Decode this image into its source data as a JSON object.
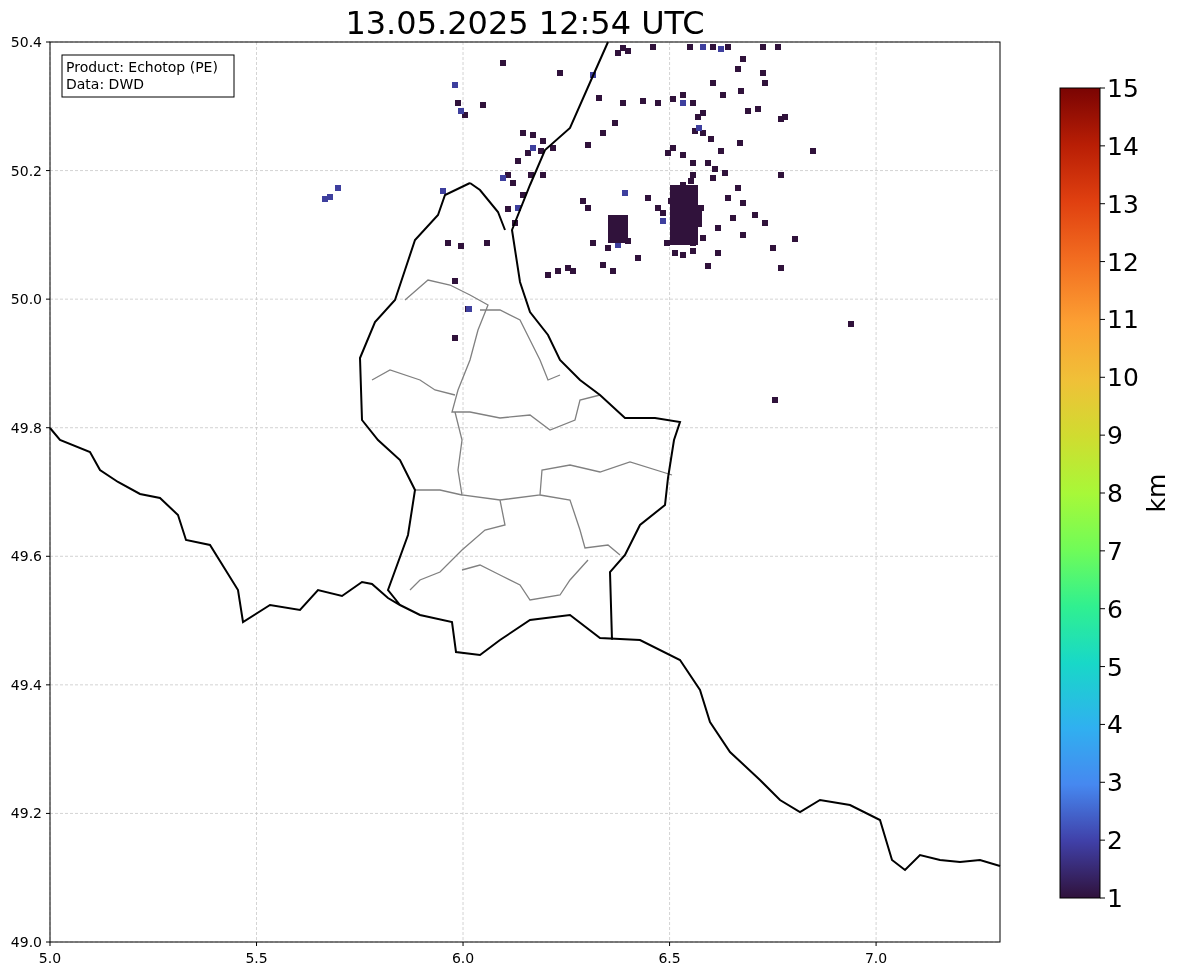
{
  "title": "13.05.2025 12:54 UTC",
  "legend": {
    "lines": [
      "Product: Echotop (PE)",
      "Data: DWD"
    ]
  },
  "x_ticks": [
    "5.0",
    "5.5",
    "6.0",
    "6.5",
    "7.0"
  ],
  "y_ticks": [
    "50.4",
    "50.2",
    "50.0",
    "49.8",
    "49.6",
    "49.4",
    "49.2",
    "49.0"
  ],
  "colorbar": {
    "label": "km",
    "ticks": [
      "15",
      "14",
      "13",
      "12",
      "11",
      "10",
      "9",
      "8",
      "7",
      "6",
      "5",
      "4",
      "3",
      "2",
      "1"
    ]
  }
}
